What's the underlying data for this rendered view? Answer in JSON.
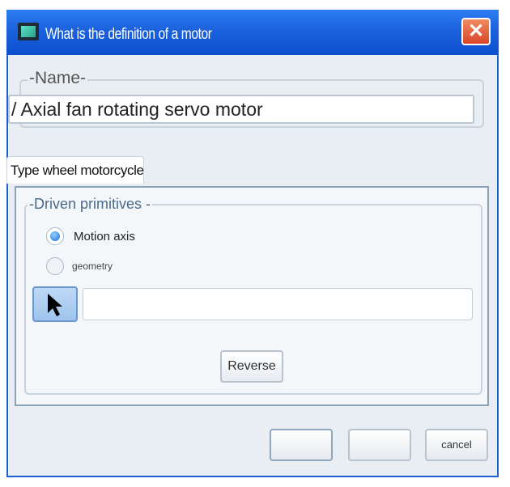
{
  "window": {
    "title": "What is the definition of a motor"
  },
  "name_group": {
    "legend": "-Name-",
    "value": "/ Axial fan rotating servo motor"
  },
  "tab": {
    "label": "Type wheel motorcycle"
  },
  "driven_group": {
    "legend": "-Driven primitives -",
    "options": [
      {
        "label": "Motion axis",
        "selected": true
      },
      {
        "label": "geometry",
        "selected": false
      }
    ]
  },
  "buttons": {
    "reverse": "Reverse",
    "ok": "",
    "apply": "",
    "cancel": "cancel"
  },
  "icons": {
    "app": "app-icon",
    "close": "close-icon",
    "pointer": "arrow-pointer-icon"
  }
}
